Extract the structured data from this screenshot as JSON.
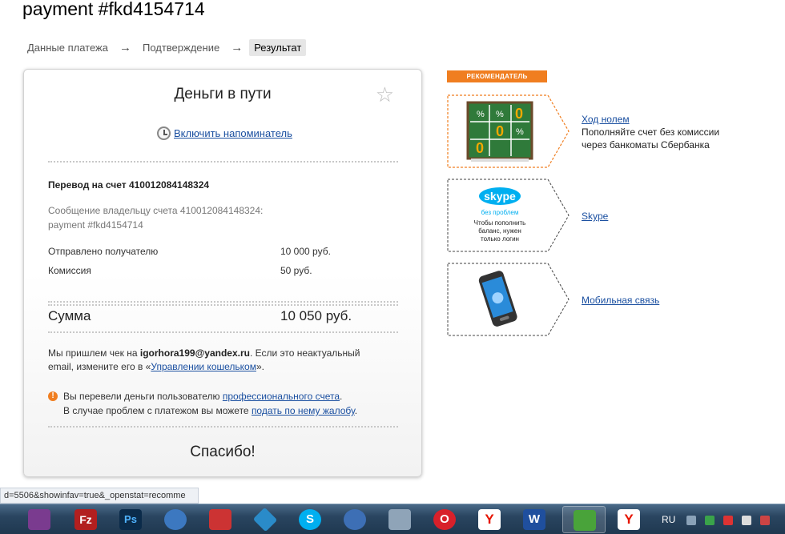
{
  "page": {
    "title": "payment #fkd4154714"
  },
  "steps": [
    {
      "label": "Данные платежа"
    },
    {
      "label": "Подтверждение"
    },
    {
      "label": "Результат"
    }
  ],
  "step_arrow": "→",
  "card": {
    "title": "Деньги в пути",
    "star_glyph": "☆",
    "reminder_link": "Включить напоминатель",
    "transfer_title": "Перевод на счет 410012084148324",
    "message_line1": "Сообщение владельцу счета 410012084148324:",
    "message_line2": "payment #fkd4154714",
    "sent_label": "Отправлено получателю",
    "sent_value": "10 000 руб.",
    "commission_label": "Комиссия",
    "commission_value": "50 руб.",
    "sum_label": "Сумма",
    "sum_value": "10 050 руб.",
    "receipt_prefix": "Мы пришлем чек на ",
    "receipt_email": "igorhora199@yandex.ru",
    "receipt_suffix": ". Если это неактуальный",
    "receipt_line2_prefix": "email, измените его в «",
    "receipt_link": "Управлении кошельком",
    "receipt_line2_suffix": "».",
    "notice_icon": "!",
    "notice_line1_prefix": "Вы перевели деньги пользователю ",
    "notice_link1": "профессионального счета",
    "notice_line1_suffix": ".",
    "notice_line2_prefix": "В случае проблем с платежом вы можете ",
    "notice_link2": "подать по нему жалобу",
    "notice_line2_suffix": ".",
    "thanks": "Спасибо!"
  },
  "recommender": {
    "badge": "РЕКОМЕНДАТЕЛЬ",
    "items": [
      {
        "link": "Ход нолем",
        "desc_line1": "Пополняйте счет без комиссии",
        "desc_line2": "через банкоматы Сбербанка",
        "image_text": "% % 0 0 % 0"
      },
      {
        "link": "Skype",
        "logo_text": "skype",
        "sub_text": "без проблем",
        "image_line1": "Чтобы пополнить",
        "image_line2": "баланс, нужен",
        "image_line3": "только логин"
      },
      {
        "link": "Мобильная связь"
      }
    ]
  },
  "status_bar": {
    "text": "d=5506&showinfav=true&_openstat=recomme"
  },
  "taskbar": {
    "lang": "RU",
    "apps": [
      {
        "name": "winrar-icon",
        "color": "#7a3b8f"
      },
      {
        "name": "filezilla-icon",
        "color": "#b21f1f",
        "label": "Fz"
      },
      {
        "name": "photoshop-icon",
        "color": "#0b2b4a",
        "label": "Ps"
      },
      {
        "name": "cursor-app-icon",
        "color": "#3c78c0"
      },
      {
        "name": "pdf-icon",
        "color": "#c33"
      },
      {
        "name": "app-diamond-icon",
        "color": "#2a8bc9"
      },
      {
        "name": "skype-icon",
        "color": "#00aff0",
        "label": "S"
      },
      {
        "name": "paint-icon",
        "color": "#3d6fb5"
      },
      {
        "name": "tools-icon",
        "color": "#8fa4b8"
      },
      {
        "name": "opera-icon",
        "color": "#d8202a",
        "label": "O"
      },
      {
        "name": "yandex-icon",
        "color": "#ffffff",
        "label": "Y"
      },
      {
        "name": "word-icon",
        "color": "#1f4f9e",
        "label": "W"
      },
      {
        "name": "torrent-icon",
        "color": "#49a33a"
      },
      {
        "name": "yandex-browser-icon",
        "color": "#ffffff",
        "label": "Y"
      }
    ]
  }
}
